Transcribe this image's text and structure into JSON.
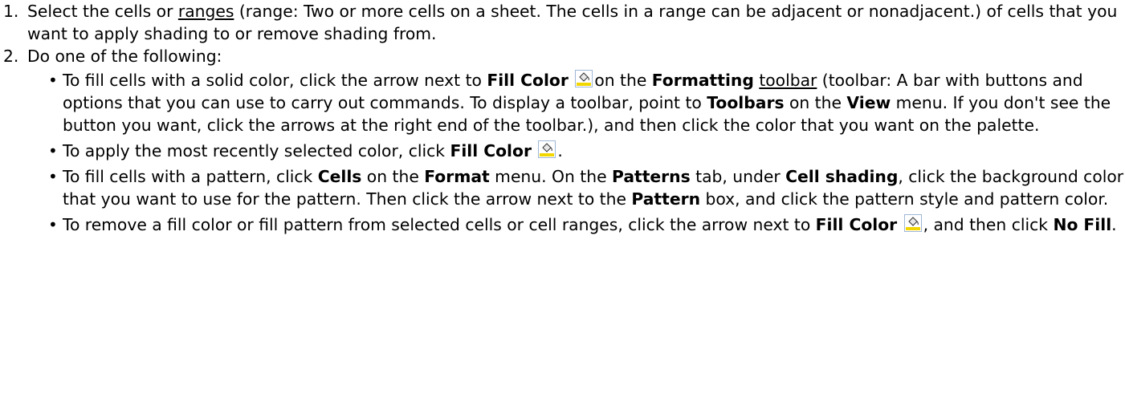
{
  "steps": [
    {
      "num": "1.",
      "t1": "Select the cells or ",
      "link": "ranges",
      "t2": " (range: Two or more cells on a sheet. The cells in a range can be adjacent or nonadjacent.) of cells that you want to apply shading to or remove shading from."
    },
    {
      "num": "2.",
      "text": "Do one of the following:"
    }
  ],
  "bullets": {
    "b1": {
      "t1": "To fill cells with a solid color, click the arrow next to ",
      "fill_color": "Fill Color",
      "t2": "on the ",
      "formatting": "Formatting",
      "t3": " ",
      "toolbar_link": "toolbar",
      "t4": " (toolbar: A bar with buttons and options that you can use to carry out commands. To display a toolbar, point to ",
      "toolbars": "Toolbars",
      "t5": " on the ",
      "view": "View",
      "t6": " menu. If you don't see the button you want, click the arrows at the right end of the toolbar.), and then click the color that you want on the palette."
    },
    "b2": {
      "t1": "To apply the most recently selected color, click ",
      "fill_color": "Fill Color",
      "t2": "."
    },
    "b3": {
      "t1": "To fill cells with a pattern, click ",
      "cells": "Cells",
      "t2": " on the ",
      "format": "Format",
      "t3": " menu. On the ",
      "patterns": "Patterns",
      "t4": " tab, under ",
      "cell_shading": "Cell shading",
      "t5": ", click the background color that you want to use for the pattern. Then click the arrow next to the ",
      "pattern": "Pattern",
      "t6": " box, and click the pattern style and pattern color."
    },
    "b4": {
      "t1": "To remove a fill color or fill pattern from selected cells or cell ranges, click the arrow next to ",
      "fill_color": "Fill Color",
      "t2": ", and then click ",
      "no_fill": "No Fill",
      "t3": "."
    }
  },
  "icons": {
    "fill_color": "fill-color-bucket-icon",
    "bucket_color": "#f2d600",
    "frame_color": "#9fb7d6"
  }
}
